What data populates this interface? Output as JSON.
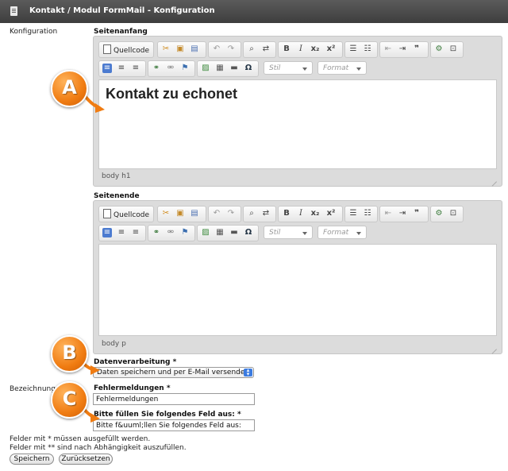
{
  "header": {
    "title": "Kontakt / Modul FormMail - Konfiguration"
  },
  "left_labels": {
    "konfiguration": "Konfiguration",
    "bezeichnung": "Bezeichnung"
  },
  "editor_top": {
    "section_label": "Seitenanfang",
    "source_button": "Quellcode",
    "style_combo": "Stil",
    "format_combo": "Format",
    "content_heading": "Kontakt zu echonet",
    "element_path": "body  h1"
  },
  "editor_bottom": {
    "section_label": "Seitenende",
    "source_button": "Quellcode",
    "style_combo": "Stil",
    "format_combo": "Format",
    "element_path": "body  p"
  },
  "toolbar_icons": [
    "cut-icon",
    "copy-icon",
    "paste-icon",
    "undo-icon",
    "redo-icon",
    "find-icon",
    "replace-icon",
    "bold-icon",
    "italic-icon",
    "subscript-icon",
    "superscript-icon",
    "numbered-list-icon",
    "bulleted-list-icon",
    "outdent-icon",
    "indent-icon",
    "blockquote-icon",
    "plugin-icon",
    "maximize-icon",
    "align-left-icon",
    "align-center-icon",
    "align-right-icon",
    "link-icon",
    "unlink-icon",
    "anchor-icon",
    "image-icon",
    "table-icon",
    "hr-icon",
    "special-char-icon"
  ],
  "datenverarbeitung": {
    "label": "Datenverarbeitung *",
    "selected": "Daten speichern und per E-Mail versenden"
  },
  "fehlermeldungen": {
    "label": "Fehlermeldungen *",
    "value": "Fehlermeldungen"
  },
  "bitte_fuellen": {
    "label": "Bitte füllen Sie folgendes Feld aus: *",
    "value": "Bitte f&uuml;llen Sie folgendes Feld aus:"
  },
  "footer": {
    "note1": "Felder mit * müssen ausgefüllt werden.",
    "note2": "Felder mit ** sind nach Abhängigkeit auszufüllen.",
    "save": "Speichern",
    "reset": "Zurücksetzen"
  },
  "callouts": {
    "a": "A",
    "b": "B",
    "c": "C"
  },
  "colors": {
    "callout": "#f07c12",
    "titlebar": "#4a4a4a",
    "select_stepper": "#3b7be0"
  }
}
